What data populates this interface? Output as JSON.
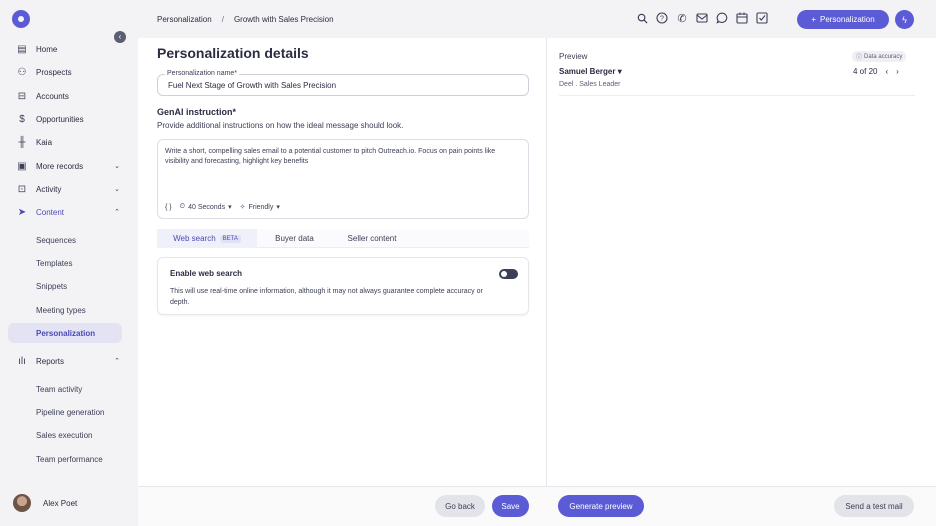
{
  "sidebar": {
    "items": [
      {
        "label": "Home",
        "icon": "home-icon"
      },
      {
        "label": "Prospects",
        "icon": "person-icon"
      },
      {
        "label": "Accounts",
        "icon": "building-icon"
      },
      {
        "label": "Opportunities",
        "icon": "dollar-icon"
      },
      {
        "label": "Kaia",
        "icon": "waveform-icon"
      },
      {
        "label": "More records",
        "icon": "records-icon"
      },
      {
        "label": "Activity",
        "icon": "activity-icon"
      },
      {
        "label": "Content",
        "icon": "send-icon"
      },
      {
        "label": "Reports",
        "icon": "bar-chart-icon"
      }
    ],
    "content_subitems": [
      "Sequences",
      "Templates",
      "Snippets",
      "Meeting types",
      "Personalization"
    ],
    "reports_subitems": [
      "Team activity",
      "Pipeline generation",
      "Sales execution",
      "Team performance"
    ],
    "user_name": "Alex Poet"
  },
  "topbar": {
    "breadcrumb_root": "Personalization",
    "breadcrumb_sep": "/",
    "breadcrumb_current": "Growth with Sales Precision",
    "new_button_label": "Personalization",
    "accent_color": "#5b5bd6"
  },
  "details": {
    "title": "Personalization details",
    "name_label": "Personalization name*",
    "name_value": "Fuel Next Stage of Growth with Sales Precision",
    "genai_title": "GenAI instruction*",
    "genai_subtitle": "Provide additional instructions on how the ideal message should look.",
    "instruction_text": "Write a short, compelling sales email to a potential customer to pitch Outreach.io. Focus on pain points like visibility and forecasting, highlight key benefits",
    "length_option": "40 Seconds",
    "tone_option": "Friendly",
    "tabs": [
      {
        "label": "Web search",
        "badge": "BETA"
      },
      {
        "label": "Buyer data"
      },
      {
        "label": "Seller content"
      }
    ],
    "web_search_title": "Enable web search",
    "web_search_desc": "This will use real-time online information, although it may not always guarantee complete accuracy or depth.",
    "web_search_enabled": false
  },
  "preview": {
    "label": "Preview",
    "accuracy_label": "Data accuracy",
    "prospect_name": "Samuel Berger",
    "prospect_role": "Deel . Sales Leader",
    "pager": "4 of 20"
  },
  "footer": {
    "go_back": "Go back",
    "save": "Save",
    "generate_preview": "Generate preview",
    "send_test": "Send a test mail"
  }
}
